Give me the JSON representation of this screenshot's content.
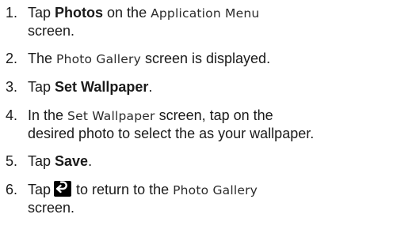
{
  "steps": [
    {
      "number": "1.",
      "t1": "Tap ",
      "bold": "Photos",
      "t2": " on the ",
      "ui": "Application Menu",
      "t3": "screen."
    },
    {
      "number": "2.",
      "t1": "The ",
      "ui": "Photo Gallery",
      "t2": " screen is displayed."
    },
    {
      "number": "3.",
      "t1": "Tap ",
      "bold": "Set Wallpaper",
      "t2": "."
    },
    {
      "number": "4.",
      "t1": "In the ",
      "ui": "Set Wallpaper",
      "t2": " screen, tap on the",
      "t3": "desired photo to select the as your wallpaper."
    },
    {
      "number": "5.",
      "t1": "Tap ",
      "bold": "Save",
      "t2": "."
    },
    {
      "number": "6.",
      "t1": "Tap",
      "icon": "back-arrow-icon",
      "t2": "to return to the ",
      "ui": "Photo Gallery",
      "t3": "screen."
    }
  ],
  "colors": {
    "text": "#1a1a1a",
    "icon_bg": "#000000",
    "icon_fg": "#ffffff"
  }
}
